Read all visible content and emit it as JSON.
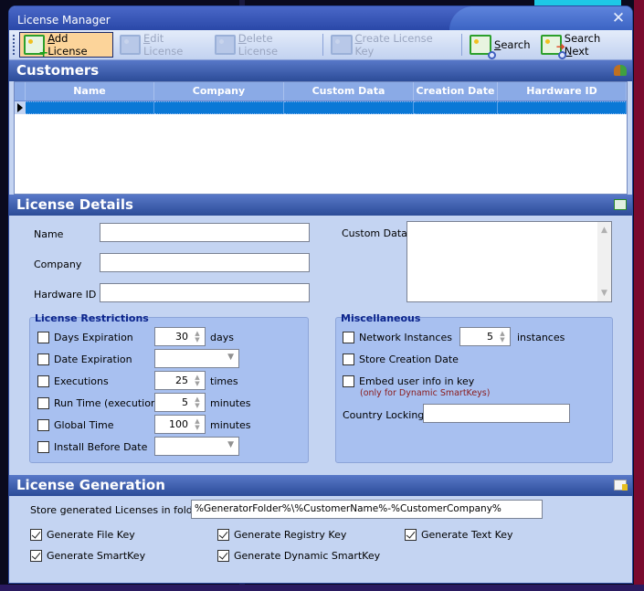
{
  "window": {
    "title": "License Manager",
    "close_label": "✕"
  },
  "toolbar": {
    "buttons": [
      {
        "label": "Add License",
        "accel": "A",
        "rest": "dd License",
        "state": "active",
        "icon": "add-license-icon"
      },
      {
        "label": "Edit License",
        "accel": "E",
        "rest": "dit License",
        "state": "disabled",
        "icon": "edit-license-icon"
      },
      {
        "label": "Delete License",
        "accel": "D",
        "rest": "elete License",
        "state": "disabled",
        "icon": "delete-license-icon"
      },
      {
        "label": "Create License Key",
        "accel": "C",
        "rest": "reate License Key",
        "state": "disabled",
        "icon": "create-key-icon"
      },
      {
        "label": "Search",
        "accel": "S",
        "rest": "earch",
        "state": "enabled",
        "icon": "search-icon"
      },
      {
        "label": "Search Next",
        "pre": "Search ",
        "accel": "N",
        "rest": "ext",
        "state": "enabled",
        "icon": "search-next-icon"
      }
    ]
  },
  "customers": {
    "title": "Customers",
    "icon": "users-icon",
    "columns": [
      "Name",
      "Company",
      "Custom Data",
      "Creation Date",
      "Hardware ID"
    ],
    "rows": [
      {
        "Name": "",
        "Company": "",
        "Custom Data": "",
        "Creation Date": "",
        "Hardware ID": "",
        "selected": true
      }
    ]
  },
  "details": {
    "title": "License Details",
    "icon": "license-card-icon",
    "fields": {
      "name": {
        "label": "Name",
        "value": ""
      },
      "company": {
        "label": "Company",
        "value": ""
      },
      "hardware_id": {
        "label": "Hardware ID",
        "value": ""
      },
      "custom_data": {
        "label": "Custom Data",
        "value": ""
      }
    },
    "restrictions": {
      "title": "License Restrictions",
      "items": [
        {
          "label": "Days Expiration",
          "checked": false,
          "value": "30",
          "unit": "days",
          "type": "spin"
        },
        {
          "label": "Date Expiration",
          "checked": false,
          "value": "",
          "type": "combo"
        },
        {
          "label": "Executions",
          "checked": false,
          "value": "25",
          "unit": "times",
          "type": "spin"
        },
        {
          "label": "Run Time (execution)",
          "checked": false,
          "value": "5",
          "unit": "minutes",
          "type": "spin"
        },
        {
          "label": "Global Time",
          "checked": false,
          "value": "100",
          "unit": "minutes",
          "type": "spin"
        },
        {
          "label": "Install Before Date",
          "checked": false,
          "value": "",
          "type": "combo"
        }
      ]
    },
    "misc": {
      "title": "Miscellaneous",
      "network_instances": {
        "label": "Network Instances",
        "checked": false,
        "value": "5",
        "unit": "instances"
      },
      "store_creation_date": {
        "label": "Store Creation Date",
        "checked": false
      },
      "embed_user_info": {
        "label": "Embed user info in key",
        "checked": false,
        "note": "(only for Dynamic SmartKeys)"
      },
      "country_locking": {
        "label": "Country Locking",
        "value": ""
      }
    }
  },
  "generation": {
    "title": "License Generation",
    "icon": "document-key-icon",
    "folder_label": "Store generated Licenses in folder:",
    "folder_value": "%GeneratorFolder%\\%CustomerName%-%CustomerCompany%",
    "options": [
      {
        "label": "Generate File Key",
        "checked": true
      },
      {
        "label": "Generate Registry Key",
        "checked": true
      },
      {
        "label": "Generate Text Key",
        "checked": true
      },
      {
        "label": "Generate SmartKey",
        "checked": true
      },
      {
        "label": "Generate Dynamic SmartKey",
        "checked": true
      }
    ]
  }
}
